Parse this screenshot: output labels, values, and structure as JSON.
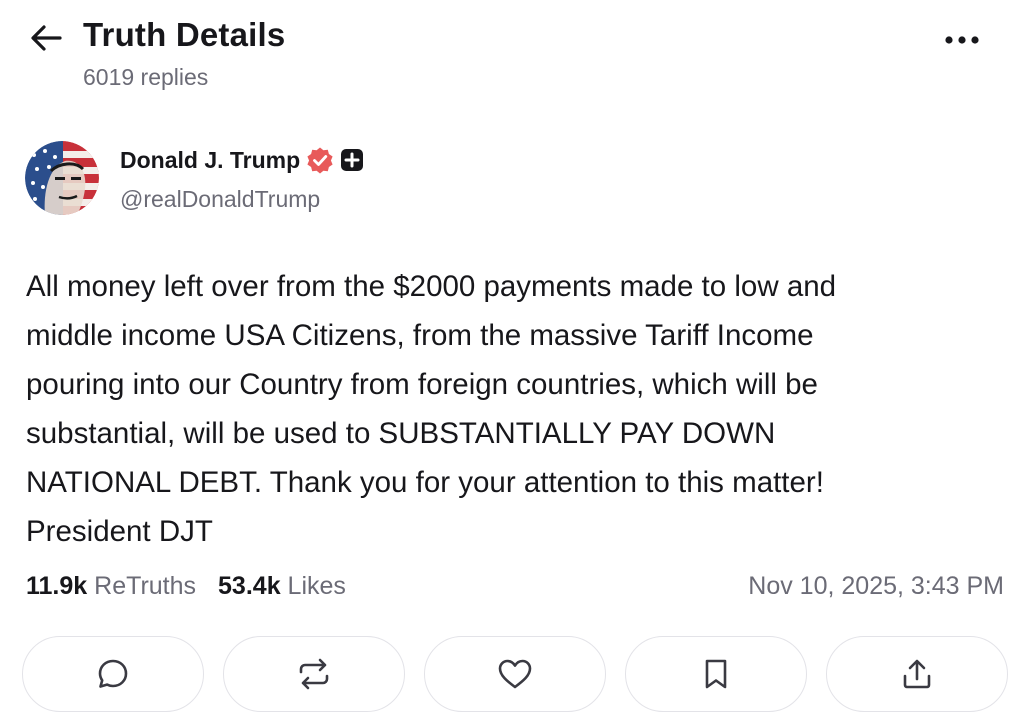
{
  "header": {
    "title": "Truth Details",
    "reply_count": "6019 replies"
  },
  "post": {
    "author": {
      "name": "Donald J. Trump",
      "handle": "@realDonaldTrump",
      "verified": true,
      "premium": true
    },
    "text": "All money left over from the $2000 payments made to low and\nmiddle income USA Citizens, from the massive Tariff Income\npouring into our Country from foreign countries, which will be\nsubstantial, will be used to SUBSTANTIALLY PAY DOWN\nNATIONAL DEBT. Thank you for your attention to this matter!\nPresident DJT",
    "stats": {
      "retruths_count": "11.9k",
      "retruths_label": "ReTruths",
      "likes_count": "53.4k",
      "likes_label": "Likes"
    },
    "timestamp": "Nov 10, 2025, 3:43 PM"
  },
  "actions": [
    {
      "icon": "reply-icon"
    },
    {
      "icon": "retruth-icon"
    },
    {
      "icon": "heart-icon"
    },
    {
      "icon": "bookmark-icon"
    },
    {
      "icon": "share-icon"
    }
  ],
  "colors": {
    "text_primary": "#17171b",
    "text_secondary": "#6b6b76",
    "verified_badge": "#e85a5a",
    "border": "#e3e3e8"
  }
}
